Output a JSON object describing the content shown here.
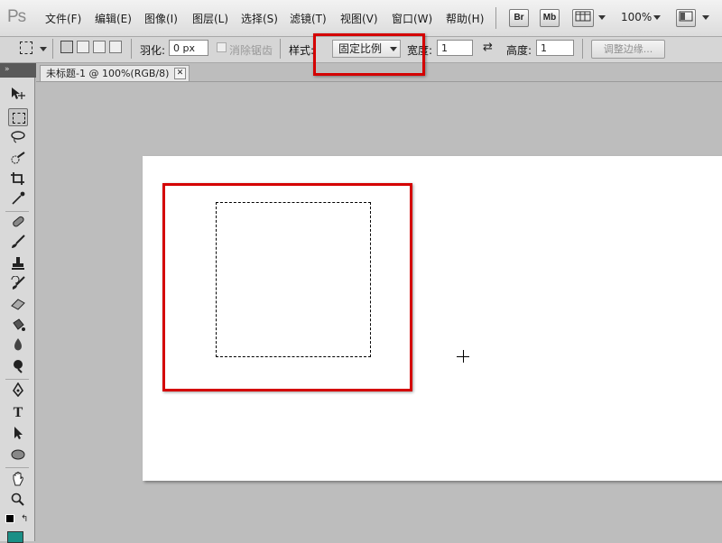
{
  "app": {
    "logo": "Ps"
  },
  "menu": {
    "items": [
      "文件(F)",
      "编辑(E)",
      "图像(I)",
      "图层(L)",
      "选择(S)",
      "滤镜(T)",
      "视图(V)",
      "窗口(W)",
      "帮助(H)"
    ],
    "bridge_label": "Br",
    "minibridge_label": "Mb",
    "zoom": "100%"
  },
  "options": {
    "feather_label": "羽化:",
    "feather_value": "0 px",
    "antialias_label": "消除锯齿",
    "style_label": "样式:",
    "style_value": "固定比例",
    "width_label": "宽度:",
    "width_value": "1",
    "height_label": "高度:",
    "height_value": "1",
    "refine_edge": "调整边缘..."
  },
  "panel_strip": {
    "collapse": "»"
  },
  "document": {
    "tab_title": "未标题-1 @ 100%(RGB/8)",
    "close": "✕"
  },
  "colors": {
    "foreground": "#1a8f86",
    "highlight": "#d40000"
  }
}
